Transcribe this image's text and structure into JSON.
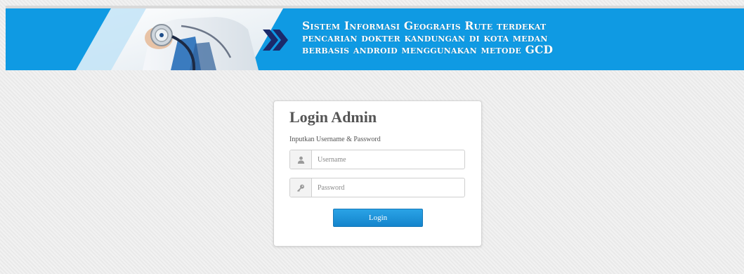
{
  "header": {
    "title_lines": [
      "Sistem Informasi Geografis  Rute terdekat",
      "pencarian dokter kandungan di kota medan",
      "berbasis android menggunakan metode GCD"
    ]
  },
  "login": {
    "title": "Login Admin",
    "subtitle": "Inputkan Username & Password",
    "username_placeholder": "Username",
    "password_placeholder": "Password",
    "username_value": "",
    "password_value": "",
    "button_label": "Login"
  },
  "colors": {
    "header_blue": "#0f9ae3",
    "button_blue": "#1a8fd6",
    "chevron_navy": "#1b2a6b"
  },
  "icons": {
    "username": "user-icon",
    "password": "key-icon",
    "banner_arrow": "double-chevron-right-icon"
  }
}
